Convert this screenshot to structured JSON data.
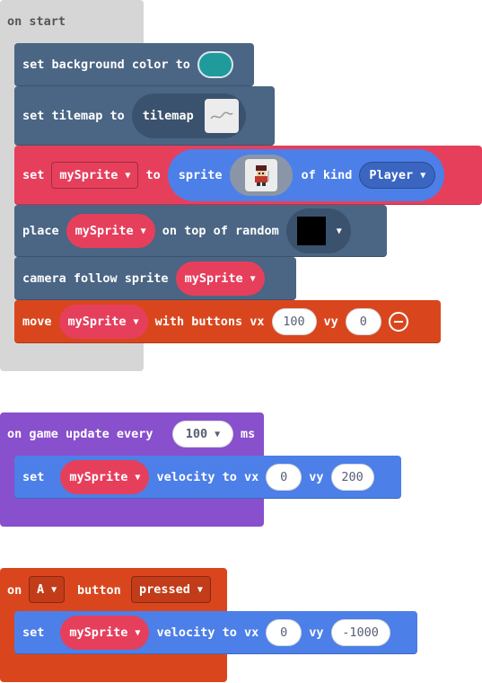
{
  "on_start": {
    "label": "on start",
    "set_bg": {
      "set": "set background color to",
      "color": "#1f9b9b"
    },
    "set_tilemap": {
      "set": "set tilemap to",
      "tilemap": "tilemap"
    },
    "set_sprite": {
      "set": "set",
      "var": "mySprite",
      "to": "to",
      "sprite": "sprite",
      "of_kind": "of kind",
      "kind": "Player"
    },
    "place": {
      "place": "place",
      "var": "mySprite",
      "on_top": "on top of random",
      "tile_color": "#000000"
    },
    "camera": {
      "text": "camera follow sprite",
      "var": "mySprite"
    },
    "move": {
      "move": "move",
      "var": "mySprite",
      "with_buttons": "with buttons vx",
      "vx": "100",
      "vy_label": "vy",
      "vy": "0"
    }
  },
  "game_update": {
    "label": "on game update every",
    "interval": "100",
    "unit": "ms",
    "set": {
      "set": "set",
      "var": "mySprite",
      "velocity": "velocity to vx",
      "vx": "0",
      "vy_label": "vy",
      "vy": "200"
    }
  },
  "button_event": {
    "on": "on",
    "button": "A",
    "button_label": "button",
    "event": "pressed",
    "set": {
      "set": "set",
      "var": "mySprite",
      "velocity": "velocity to vx",
      "vx": "0",
      "vy_label": "vy",
      "vy": "-1000"
    }
  },
  "colors": {
    "event_grey": "#d6d6d6",
    "scene_slate": "#4b6584",
    "sprites_red": "#e63f5c",
    "sprites_blue": "#4c7fe8",
    "controller_orange": "#d9461e",
    "game_purple": "#8850cc"
  }
}
